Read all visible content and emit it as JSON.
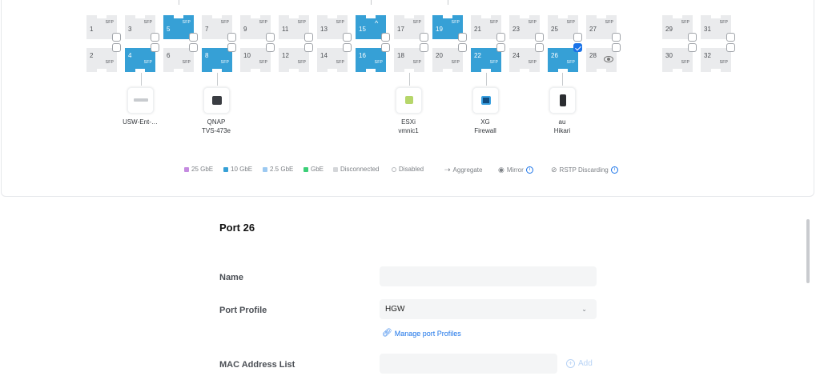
{
  "switch": {
    "top_ports": [
      "1",
      "3",
      "5",
      "7",
      "9",
      "11",
      "13",
      "15",
      "17",
      "19",
      "21",
      "23",
      "25",
      "27"
    ],
    "bottom_ports": [
      "2",
      "4",
      "6",
      "8",
      "10",
      "12",
      "14",
      "16",
      "18",
      "20",
      "22",
      "24",
      "26",
      "28"
    ],
    "top_ports_right": [
      "29",
      "31"
    ],
    "bottom_ports_right": [
      "30",
      "32"
    ],
    "port_type_label": "SFP",
    "active_ports": [
      "4",
      "5",
      "8",
      "15",
      "16",
      "19",
      "22"
    ],
    "selected_port": "26",
    "active_color": "#36a0d6"
  },
  "devices": [
    {
      "line1": "USW-Ent-…",
      "line2": "",
      "icon": "switch-device-icon"
    },
    {
      "line1": "QNAP",
      "line2": "TVS-473e",
      "icon": "nas-device-icon"
    },
    {
      "line1": "ESXi",
      "line2": "vmnic1",
      "icon": "server-device-icon"
    },
    {
      "line1": "XG",
      "line2": "Firewall",
      "icon": "firewall-device-icon"
    },
    {
      "line1": "au",
      "line2": "Hikari",
      "icon": "gateway-device-icon"
    }
  ],
  "legend": {
    "speed_25": "25 GbE",
    "speed_10": "10 GbE",
    "speed_2_5": "2.5 GbE",
    "speed_1": "GbE",
    "disconnected": "Disconnected",
    "disabled": "Disabled",
    "aggregate": "Aggregate",
    "mirror": "Mirror",
    "rstp": "RSTP Discarding",
    "colors": {
      "speed_25": "#c58be0",
      "speed_10": "#36a0d6",
      "speed_2_5": "#9cc9f1",
      "speed_1": "#3ccf78",
      "disconnected": "#d4d6d9"
    }
  },
  "form": {
    "title": "Port 26",
    "name_label": "Name",
    "name_value": "",
    "profile_label": "Port Profile",
    "profile_value": "HGW",
    "manage_link": "Manage port Profiles",
    "mac_label": "MAC Address List",
    "mac_value": "",
    "add_label": "Add"
  }
}
